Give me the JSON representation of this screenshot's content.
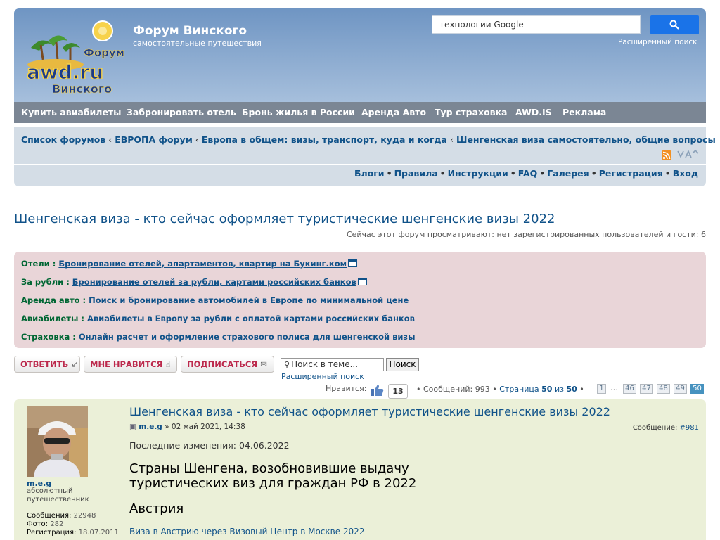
{
  "header": {
    "logo_text_1": "Форум",
    "logo_text_2": "awd.ru",
    "logo_text_3": "Винского",
    "site_title": "Форум Винского",
    "site_desc": "самостоятельные путешествия",
    "search_placeholder": "технологии Google",
    "advanced_search": "Расширенный поиск"
  },
  "nav": [
    "Купить авиабилеты",
    "Забронировать отель",
    "Бронь жилья в России",
    "Аренда Авто",
    "Тур страховка",
    "AWD.IS",
    "Реклама"
  ],
  "breadcrumbs": [
    "Список форумов",
    "ЕВРОПА форум",
    "Европа в общем: визы, транспорт, куда и когда",
    "Шенгенская виза самостоятельно, общие вопросы"
  ],
  "breadcrumb_sep": "‹",
  "userlinks": [
    "Блоги",
    "Правила",
    "Инструкции",
    "FAQ",
    "Галерея",
    "Регистрация",
    "Вход"
  ],
  "topic": {
    "title": "Шенгенская виза - кто сейчас оформляет туристические шенгенские визы 2022",
    "viewers": "Сейчас этот форум просматривают: нет зарегистрированных пользователей и гости: 6"
  },
  "ads": [
    {
      "label": "Отели",
      "text": "Бронирование отелей, апартаментов, квартир на Букинг.ком"
    },
    {
      "label": "За рубли",
      "text": "Бронирование отелей за рубли, картами российских банков"
    },
    {
      "label": "Аренда авто",
      "text": "Поиск и бронирование автомобилей в Европе по минимальной цене"
    },
    {
      "label": "Авиабилеты",
      "text": "Авиабилеты в Европу за рубли с оплатой картами российских банков"
    },
    {
      "label": "Страховка",
      "text": "Онлайн расчет и оформление страхового полиса для шенгенской визы"
    }
  ],
  "actions": {
    "reply": "ОТВЕТИТЬ",
    "like": "МНЕ НРАВИТСЯ",
    "subscribe": "ПОДПИСАТЬСЯ",
    "search_placeholder": "Поиск в теме...",
    "search_button": "Поиск",
    "advanced_search": "Расширенный поиск"
  },
  "pagination": {
    "likes_label": "Нравится:",
    "likes_count": "13",
    "posts_label": "Сообщений:",
    "posts_count": "993",
    "page_label": "Страница",
    "page_current": "50",
    "page_of": "из",
    "page_total": "50",
    "pages": [
      "1",
      "…",
      "46",
      "47",
      "48",
      "49",
      "50"
    ]
  },
  "post": {
    "title": "Шенгенская виза - кто сейчас оформляет туристические шенгенские визы 2022",
    "author": "m.e.g",
    "date": "» 02 май 2021, 14:38",
    "number_label": "Сообщение:",
    "number": "#981",
    "rank": "абсолютный путешественник",
    "posts_label": "Сообщения:",
    "posts_value": "22948",
    "photos_label": "Фото:",
    "photos_value": "282",
    "reg_label": "Регистрация:",
    "reg_value": "18.07.2011",
    "edited": "Последние изменения: 04.06.2022",
    "heading": "Страны Шенгена, возобновившие выдачу туристических виз для граждан РФ в 2022",
    "country": "Австрия",
    "link": "Виза в Австрию через Визовый Центр в Москве 2022"
  },
  "colors": {
    "header_top": "#6f95c3",
    "nav_bg": "#7b8694",
    "link": "#105289",
    "ad_bg": "#e9d5d8",
    "button_text": "#bc2a4d",
    "post_bg": "#ebf0d8"
  }
}
